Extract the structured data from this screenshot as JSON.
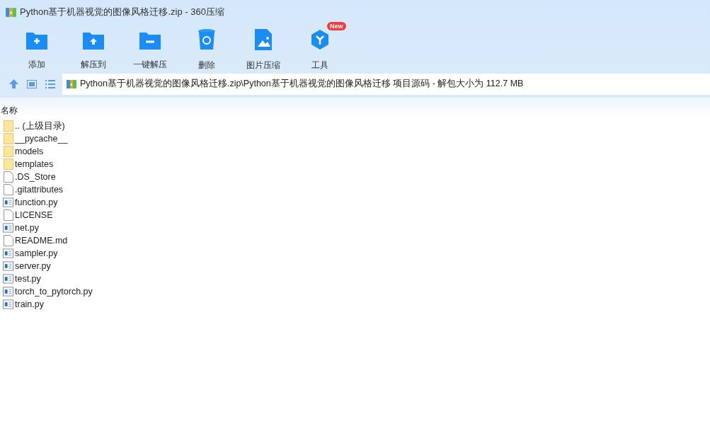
{
  "window": {
    "title": "Python基于机器视觉的图像风格迁移.zip - 360压缩"
  },
  "toolbar": [
    {
      "label": "添加",
      "kind": "add"
    },
    {
      "label": "解压到",
      "kind": "extract"
    },
    {
      "label": "一键解压",
      "kind": "quick"
    },
    {
      "label": "删除",
      "kind": "delete"
    },
    {
      "label": "图片压缩",
      "kind": "image"
    },
    {
      "label": "工具",
      "kind": "tools",
      "badge": "New"
    }
  ],
  "path": "Python基于机器视觉的图像风格迁移.zip\\Python基于机器视觉的图像风格迁移 项目源码 - 解包大小为 112.7 MB",
  "columns": [
    "名称"
  ],
  "files": [
    {
      "name": ".. (上级目录)",
      "kind": "folder"
    },
    {
      "name": "__pycache__",
      "kind": "folder"
    },
    {
      "name": "models",
      "kind": "folder"
    },
    {
      "name": "templates",
      "kind": "folder"
    },
    {
      "name": ".DS_Store",
      "kind": "file"
    },
    {
      "name": ".gitattributes",
      "kind": "file"
    },
    {
      "name": "function.py",
      "kind": "script"
    },
    {
      "name": "LICENSE",
      "kind": "file"
    },
    {
      "name": "net.py",
      "kind": "script"
    },
    {
      "name": "README.md",
      "kind": "file"
    },
    {
      "name": "sampler.py",
      "kind": "script"
    },
    {
      "name": "server.py",
      "kind": "script"
    },
    {
      "name": "test.py",
      "kind": "script"
    },
    {
      "name": "torch_to_pytorch.py",
      "kind": "script"
    },
    {
      "name": "train.py",
      "kind": "script"
    }
  ]
}
